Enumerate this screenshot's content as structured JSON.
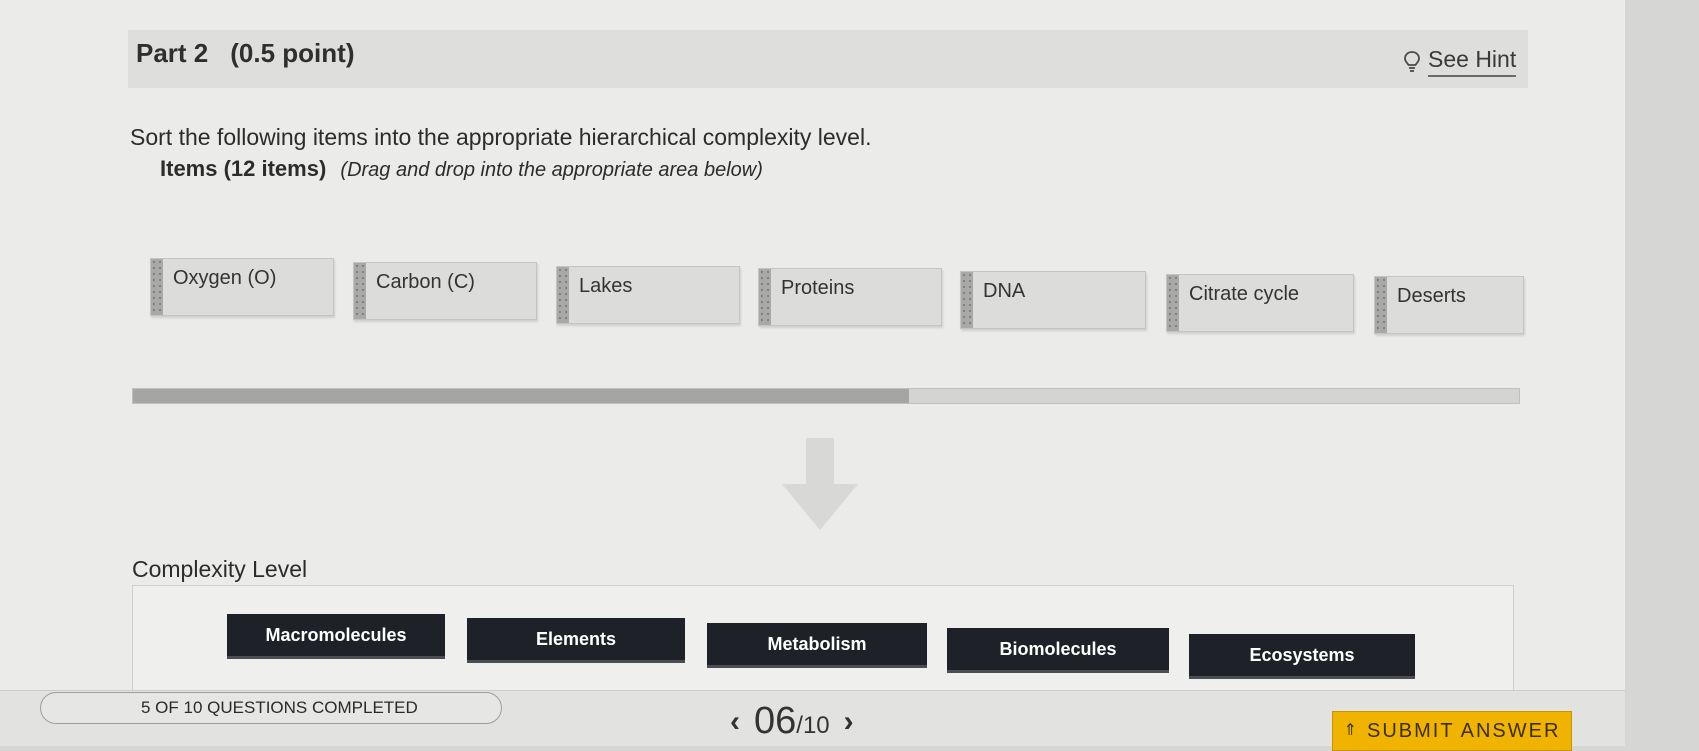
{
  "part": {
    "title": "Part 2",
    "points": "(0.5 point)"
  },
  "hint": {
    "label": "See Hint",
    "icon": "lightbulb-icon"
  },
  "instructions": "Sort the following items into the appropriate hierarchical complexity level.",
  "items_header": {
    "count_label": "Items (12 items)",
    "note": "(Drag and drop into the appropriate area below)"
  },
  "items": [
    {
      "label": "Oxygen (O)"
    },
    {
      "label": "Carbon (C)"
    },
    {
      "label": "Lakes"
    },
    {
      "label": "Proteins"
    },
    {
      "label": "DNA"
    },
    {
      "label": "Citrate cycle"
    },
    {
      "label": "Deserts"
    }
  ],
  "scroll_progress_fraction": 0.56,
  "complexity": {
    "label": "Complexity Level",
    "buckets": [
      {
        "label": "Macromolecules"
      },
      {
        "label": "Elements"
      },
      {
        "label": "Metabolism"
      },
      {
        "label": "Biomolecules"
      },
      {
        "label": "Ecosystems"
      }
    ]
  },
  "footer": {
    "status": "5 OF 10 QUESTIONS COMPLETED",
    "current": "06",
    "total": "/10",
    "prev": "‹",
    "next": "›",
    "submit": "SUBMIT ANSWER"
  },
  "colors": {
    "bucket_bg": "#1e2228",
    "submit_bg": "#f0b400",
    "page_bg": "#ebebe9"
  }
}
